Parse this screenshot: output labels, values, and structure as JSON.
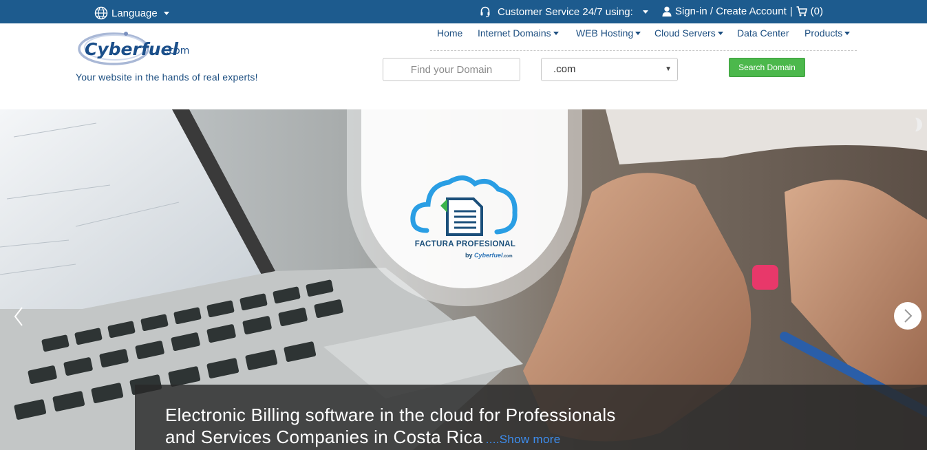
{
  "topbar": {
    "language_label": "Language",
    "customer_service_label": "Customer Service 24/7 using:",
    "signin_label": "Sign-in / Create Account",
    "separator": "|",
    "cart_count": "(0)"
  },
  "header": {
    "logo_text": "Cyberfuel",
    "logo_suffix": ".com",
    "tagline": "Your website in the hands of real experts!"
  },
  "nav": {
    "items": [
      {
        "label": "Home",
        "has_dropdown": false
      },
      {
        "label": "Internet Domains",
        "has_dropdown": true
      },
      {
        "label": "WEB Hosting",
        "has_dropdown": true
      },
      {
        "label": "Cloud Servers",
        "has_dropdown": true
      },
      {
        "label": "Data Center",
        "has_dropdown": false
      },
      {
        "label": "Products",
        "has_dropdown": true
      }
    ]
  },
  "search": {
    "placeholder": "Find your Domain",
    "tld_selected": ".com",
    "button_label": "Search Domain"
  },
  "hero": {
    "badge_title": "FACTURA PROFESIONAL",
    "badge_by": "by",
    "badge_by_brand": "Cyberfuel",
    "badge_by_suffix": ".com",
    "caption_line1": "Electronic Billing software in the cloud for Professionals",
    "caption_line2": "and Services Companies in Costa Rica",
    "show_more": "....Show more"
  },
  "colors": {
    "topbar_bg": "#1d5b8e",
    "brand_blue": "#1c4e80",
    "search_button": "#4cb84c",
    "show_more_link": "#3d8ef0"
  },
  "icons": {
    "language": "globe-icon",
    "customer_service": "headset-icon",
    "signin": "user-icon",
    "cart": "cart-icon",
    "slider_prev": "chevron-left-icon",
    "slider_next": "chevron-right-icon"
  }
}
